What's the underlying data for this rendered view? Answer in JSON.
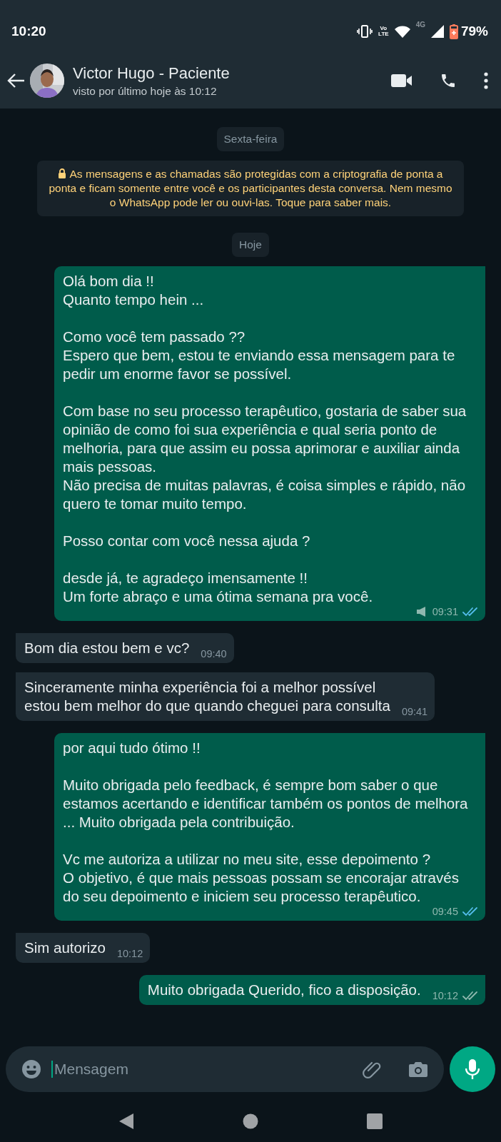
{
  "status_bar": {
    "time": "10:20",
    "volte": "Vo\nLTE",
    "network": "4G",
    "battery": "79%"
  },
  "header": {
    "name": "Victor Hugo - Paciente",
    "status": "visto por último hoje às 10:12"
  },
  "chat": [
    {
      "kind": "date",
      "text": "Sexta-feira"
    },
    {
      "kind": "notice",
      "text": "As mensagens e as chamadas são protegidas com a criptografia de ponta a ponta e ficam somente entre você e os participantes desta conversa. Nem mesmo o WhatsApp pode ler ou ouvi-las. Toque para saber mais."
    },
    {
      "kind": "date",
      "text": "Hoje"
    },
    {
      "kind": "outgoing",
      "text": "Olá bom dia !!\nQuanto tempo hein ...\n\nComo você tem passado ??\nEspero que bem, estou te enviando essa mensagem para te pedir um enorme favor se possível.\n\nCom base no seu processo terapêutico, gostaria de saber sua opinião de como foi sua experiência e qual seria ponto de melhoria, para que assim eu possa aprimorar e auxiliar ainda mais pessoas.\nNão precisa de muitas palavras, é coisa simples e rápido, não quero te tomar muito tempo.\n\nPosso contar com você nessa ajuda ?\n\ndesde já, te agradeço imensamente !!\nUm forte abraço e uma ótima semana pra você.",
      "time": "09:31",
      "broadcast": true,
      "read": true
    },
    {
      "kind": "incoming",
      "text": "Bom dia estou bem e vc?",
      "time": "09:40"
    },
    {
      "kind": "incoming",
      "text": "Sinceramente minha experiência foi a melhor possível\nestou bem melhor do que quando cheguei para consulta",
      "time": "09:41"
    },
    {
      "kind": "outgoing",
      "text": "por aqui tudo ótimo !!\n\nMuito obrigada pelo feedback, é sempre bom saber o que estamos acertando e identificar também os pontos de melhora ... Muito obrigada pela contribuição.\n\nVc me autoriza a utilizar no meu site, esse depoimento ?\nO objetivo, é que mais pessoas possam se encorajar através do seu depoimento e iniciem seu processo terapêutico.",
      "time": "09:45",
      "broadcast": false,
      "read": true
    },
    {
      "kind": "incoming",
      "text": "Sim autorizo",
      "time": "10:12"
    },
    {
      "kind": "outgoing",
      "text": "Muito obrigada Querido, fico a disposição.",
      "time": "10:12",
      "broadcast": false,
      "read": false
    }
  ],
  "composer": {
    "placeholder": "Mensagem"
  }
}
